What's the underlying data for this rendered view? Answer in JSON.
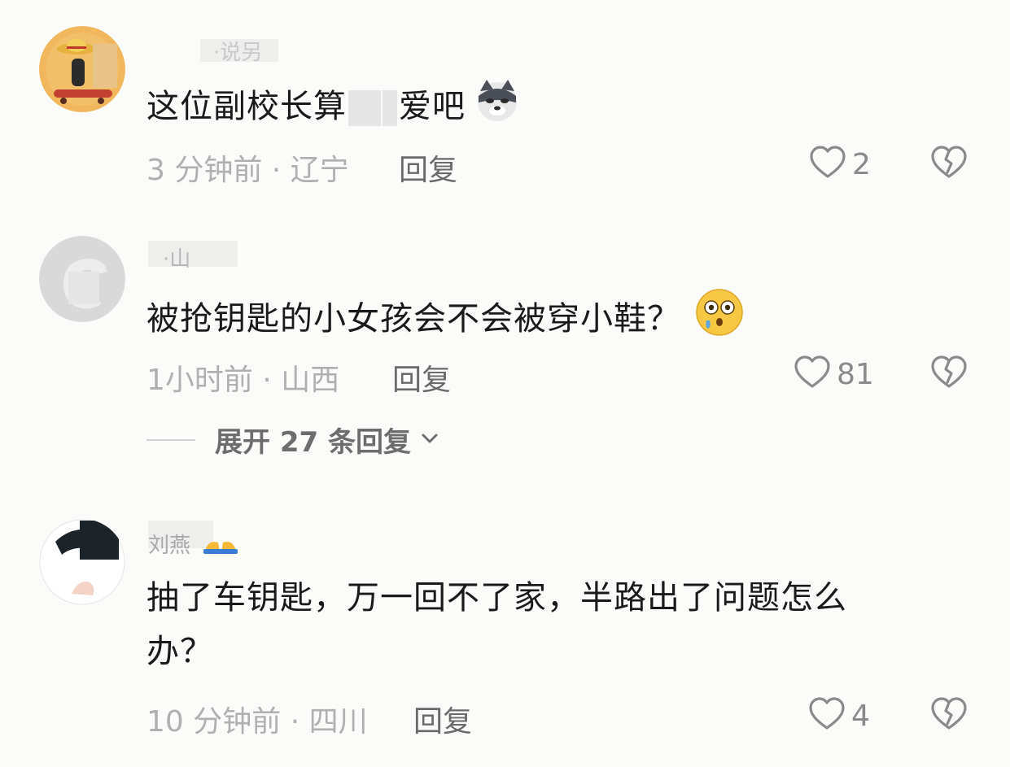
{
  "comments": [
    {
      "username": "·说另",
      "content": "这位副校长算█ █爱吧",
      "content_pre": "这位副校长算",
      "content_post": "爱吧",
      "emoji": "wolf-dog-emoji",
      "time_location": "3 分钟前 · 辽宁",
      "reply_label": "回复",
      "likes": "2"
    },
    {
      "username": "·山",
      "content": "被抢钥匙的小女孩会不会被穿小鞋？",
      "emoji": "flushed-face-emoji",
      "time_location": "1小时前 · 山西",
      "reply_label": "回复",
      "likes": "81",
      "expand_label": "展开 27 条回复"
    },
    {
      "username": "刘燕",
      "username_emoji": "folded-hands-emoji",
      "content_line1": "抽了车钥匙，万一回不了家，半路出了问题怎么",
      "content_line2": "办？",
      "time_location": "10 分钟前 · 四川",
      "reply_label": "回复",
      "likes": "4"
    }
  ],
  "colors": {
    "background": "#fbfbf9",
    "text": "#1a1a1a",
    "meta": "#b0b0b0",
    "reply": "#6a6a6a",
    "icon": "#8a8a8a"
  }
}
